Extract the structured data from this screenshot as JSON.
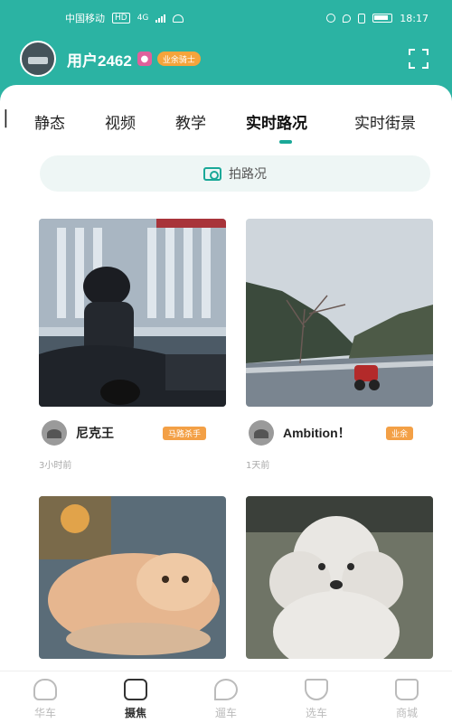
{
  "status_bar": {
    "carrier": "中国移动",
    "network": "HD",
    "signal": "4G",
    "time": "18:17"
  },
  "header": {
    "username": "用户2462",
    "location_icon": "location-pin-icon",
    "level_badge": "业余骑士",
    "scan_icon": "scan-frame-icon"
  },
  "tabs": {
    "items": [
      {
        "label": "静态"
      },
      {
        "label": "视频"
      },
      {
        "label": "教学"
      },
      {
        "label": "实时路况"
      },
      {
        "label": "实时街景"
      }
    ],
    "active_index": 3,
    "accent_color": "#1aa898"
  },
  "shoot_bar": {
    "icon": "camera-icon",
    "label": "拍路况"
  },
  "posts": [
    {
      "author": "尼克王",
      "badge": "马路杀手",
      "time": "3小时前",
      "image": "motorcycle-rider-photo"
    },
    {
      "author": "Ambition！",
      "badge": "业余",
      "time": "1天前",
      "image": "mountain-road-motorcycle-photo"
    },
    {
      "author": "",
      "badge": "",
      "time": "",
      "image": "cat-photo"
    },
    {
      "author": "",
      "badge": "",
      "time": "",
      "image": "poodle-dog-photo"
    }
  ],
  "bottom_nav": {
    "items": [
      {
        "label": "华车",
        "icon": "helmet-icon"
      },
      {
        "label": "摄焦",
        "icon": "gallery-icon"
      },
      {
        "label": "遛车",
        "icon": "map-pin-icon"
      },
      {
        "label": "选车",
        "icon": "shield-icon"
      },
      {
        "label": "商城",
        "icon": "shopping-bag-icon"
      }
    ],
    "active_index": 1
  },
  "colors": {
    "brand": "#2bb3a3",
    "badge_orange": "#f3a046"
  }
}
